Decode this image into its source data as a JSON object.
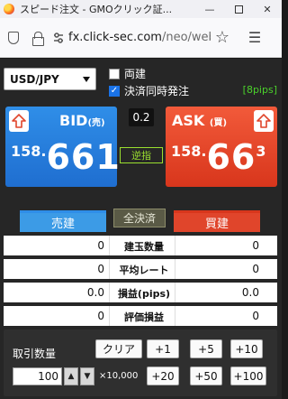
{
  "window": {
    "title": "スピード注文 - GMOクリック証...",
    "minimize": "—",
    "close": "✕"
  },
  "urlbar": {
    "domain": "fx.click-sec.com",
    "path": "/neo/web,",
    "star": "☆",
    "menu": "☰"
  },
  "panel": {
    "pair": "USD/JPY",
    "hedge_label": "両建",
    "hedge_checked": false,
    "settle_label": "決済同時発注",
    "settle_checked": true,
    "check_mark": "✓",
    "pips_range": "[8pips]",
    "spread": "0.2",
    "limit_button": "逆指",
    "bid": {
      "label": "BID",
      "sub": "(売)",
      "price_big_figure": "158.",
      "price_main": "66",
      "price_pip": "1"
    },
    "ask": {
      "label": "ASK",
      "sub": "(買)",
      "price_big_figure": "158.",
      "price_main": "66",
      "price_pip": "3"
    },
    "sell_header": "売建",
    "buy_header": "買建",
    "flatten_button": "全決済",
    "rows": [
      {
        "label": "建玉数量",
        "sell": "0",
        "buy": "0"
      },
      {
        "label": "平均レート",
        "sell": "0",
        "buy": "0"
      },
      {
        "label": "損益(pips)",
        "sell": "0.0",
        "buy": "0.0"
      },
      {
        "label": "評価損益",
        "sell": "0",
        "buy": "0"
      }
    ],
    "quantity": {
      "label": "取引数量",
      "value": "100",
      "up": "▲",
      "down": "▼",
      "unit": "×10,000",
      "clear": "クリア",
      "buttons": [
        "+1",
        "+5",
        "+10",
        "+20",
        "+50",
        "+100"
      ]
    },
    "colors": {
      "bid": "#2f8ee8",
      "ask": "#e0452b",
      "pips": "#4bd12b",
      "limit": "#9adf2f"
    }
  }
}
